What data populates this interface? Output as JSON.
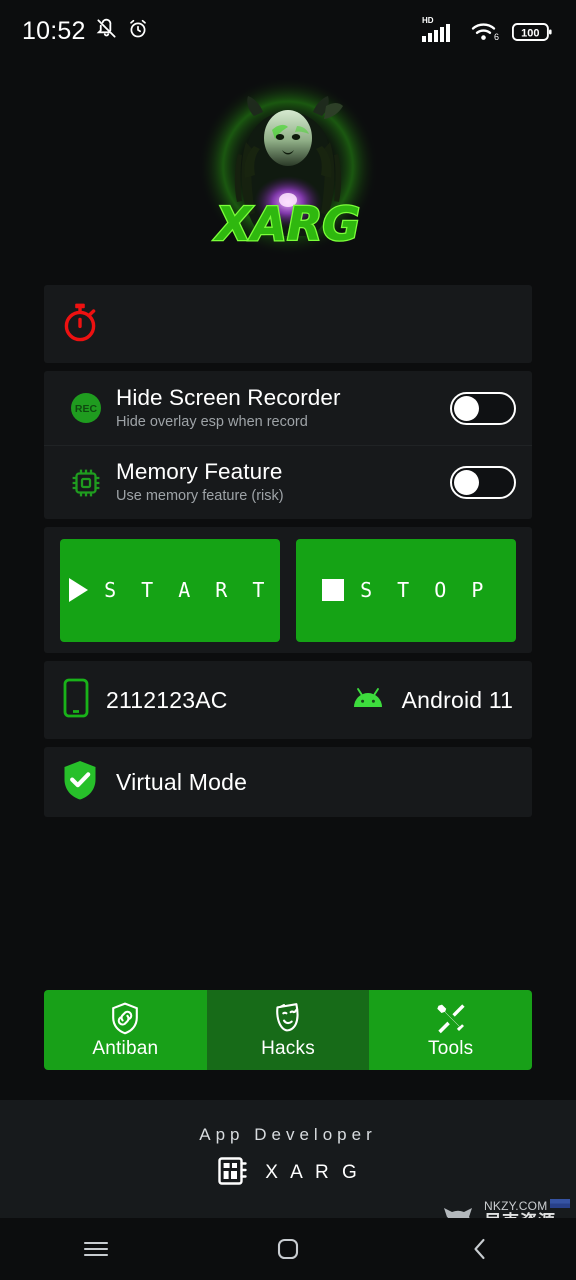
{
  "status_bar": {
    "time": "10:52",
    "icons_left": [
      "mute-icon",
      "alarm-icon"
    ],
    "network_label": "HD",
    "wifi_label": "6",
    "battery_level": "100"
  },
  "logo": {
    "name": "xarg-logo",
    "wordmark": "XARG",
    "accent_color": "#3ecb1a"
  },
  "timer_card": {
    "icon": "stopwatch-icon",
    "icon_color": "#ee1111",
    "value": ""
  },
  "toggles": [
    {
      "icon": "rec-badge-icon",
      "title": "Hide Screen Recorder",
      "subtitle": "Hide overlay esp when record",
      "state": "off"
    },
    {
      "icon": "memory-chip-icon",
      "title": "Memory Feature",
      "subtitle": "Use memory feature (risk)",
      "state": "off"
    }
  ],
  "actions": {
    "start_label": "S T A R T",
    "stop_label": "S T O P",
    "button_color": "#15a315"
  },
  "device": {
    "model_icon": "phone-icon",
    "model": "2112123AC",
    "os_icon": "android-icon",
    "os": "Android 11"
  },
  "virtual_mode": {
    "icon": "shield-check-icon",
    "label": "Virtual Mode"
  },
  "bottom_nav": {
    "items": [
      {
        "label": "Antiban",
        "icon": "shield-link-icon",
        "selected": false
      },
      {
        "label": "Hacks",
        "icon": "theater-mask-icon",
        "selected": true
      },
      {
        "label": "Tools",
        "icon": "wrench-screwdriver-icon",
        "selected": false
      }
    ],
    "active_color": "#18a018",
    "selected_color": "#176b18"
  },
  "footer": {
    "title": "App Developer",
    "icon": "chip-grid-icon",
    "developer": "X A R G"
  },
  "watermark": {
    "icon": "cat-face-icon",
    "site": "NKZY.COM",
    "site_cn": "尼克资源网"
  },
  "system_nav": {
    "recents": "recents-icon",
    "home": "home-icon",
    "back": "back-icon"
  }
}
